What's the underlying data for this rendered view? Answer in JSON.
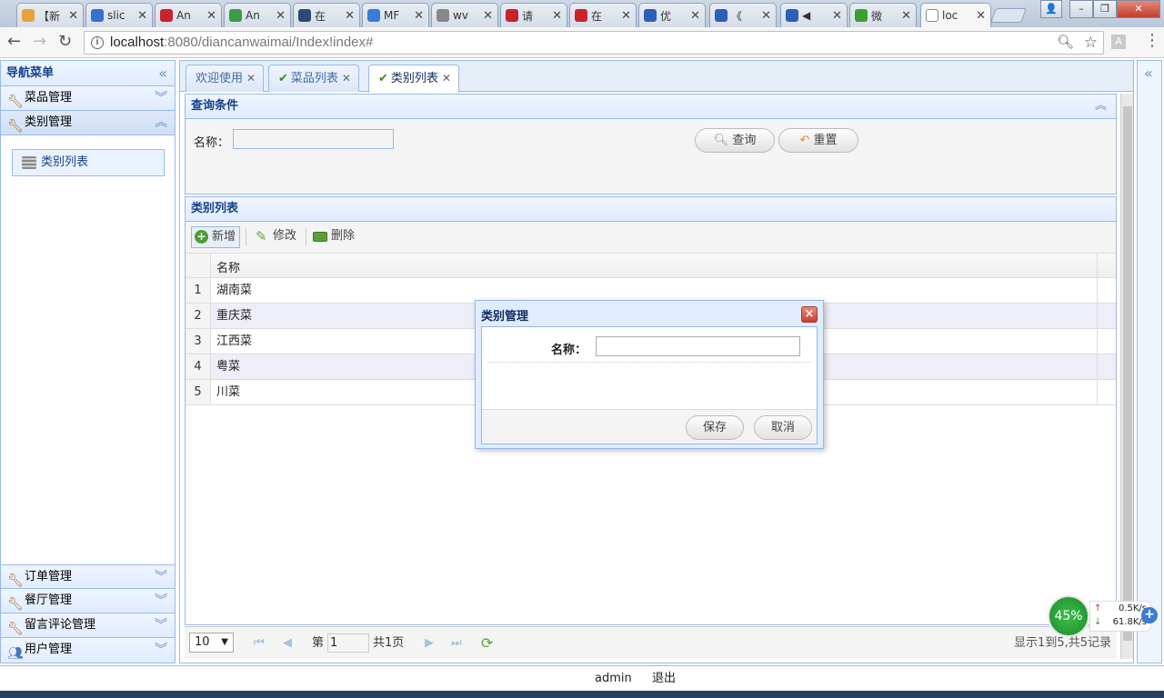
{
  "browser": {
    "tabs": [
      {
        "label": "【新",
        "fav": "#e8a23a",
        "ico": "weather-icon"
      },
      {
        "label": "slic",
        "fav": "#3a6fd0",
        "ico": "paw-icon"
      },
      {
        "label": "An",
        "fav": "#c8232c",
        "ico": "c-icon"
      },
      {
        "label": "An",
        "fav": "#3a9b4a",
        "ico": "c-icon"
      },
      {
        "label": "在",
        "fav": "#2d4a73",
        "ico": "t-icon"
      },
      {
        "label": "MF",
        "fav": "#3a7bd5",
        "ico": "mf-icon"
      },
      {
        "label": "wv",
        "fav": "#888888",
        "ico": "paw-icon"
      },
      {
        "label": "请",
        "fav": "#c8232c",
        "ico": "c-icon"
      },
      {
        "label": "在",
        "fav": "#c8232c",
        "ico": "c-icon"
      },
      {
        "label": "优",
        "fav": "#2d5fb8",
        "ico": "play-icon"
      },
      {
        "label": "《",
        "fav": "#2d5fb8",
        "ico": "play-icon"
      },
      {
        "label": "◀",
        "fav": "#2d5fb8",
        "ico": "play-icon"
      },
      {
        "label": "微",
        "fav": "#3aa02f",
        "ico": "wechat-icon"
      },
      {
        "label": "loc",
        "fav": "#ffffff",
        "ico": "page-icon"
      }
    ],
    "url_host": "localhost",
    "url_rest": ":8080/diancanwaimai/Index!index#"
  },
  "sidebar": {
    "title": "导航菜单",
    "sections_top": [
      "菜品管理",
      "类别管理"
    ],
    "active_item": "类别列表",
    "sections_bottom": [
      "订单管理",
      "餐厅管理",
      "留言评论管理",
      "用户管理"
    ]
  },
  "main": {
    "tabs": [
      "欢迎使用",
      "菜品列表",
      "类别列表"
    ],
    "query": {
      "title": "查询条件",
      "name_label": "名称：",
      "name_value": "",
      "search_btn": "查询",
      "reset_btn": "重置"
    },
    "list": {
      "title": "类别列表",
      "toolbar": {
        "add": "新增",
        "edit": "修改",
        "delete": "删除"
      },
      "column": "名称",
      "rows": [
        {
          "n": "1",
          "name": "湖南菜"
        },
        {
          "n": "2",
          "name": "重庆菜"
        },
        {
          "n": "3",
          "name": "江西菜"
        },
        {
          "n": "4",
          "name": "粤菜"
        },
        {
          "n": "5",
          "name": "川菜"
        }
      ]
    },
    "pager": {
      "page_size": "10",
      "page_prefix": "第",
      "page_value": "1",
      "page_total": "共1页",
      "summary": "显示1到5,共5记录"
    }
  },
  "dialog": {
    "title": "类别管理",
    "name_label": "名称：",
    "name_value": "",
    "save": "保存",
    "cancel": "取消"
  },
  "footer": {
    "user": "admin",
    "logout": "退出"
  },
  "speed": {
    "percent": "45%",
    "up": "0.5K/s",
    "down": "61.8K/s"
  }
}
